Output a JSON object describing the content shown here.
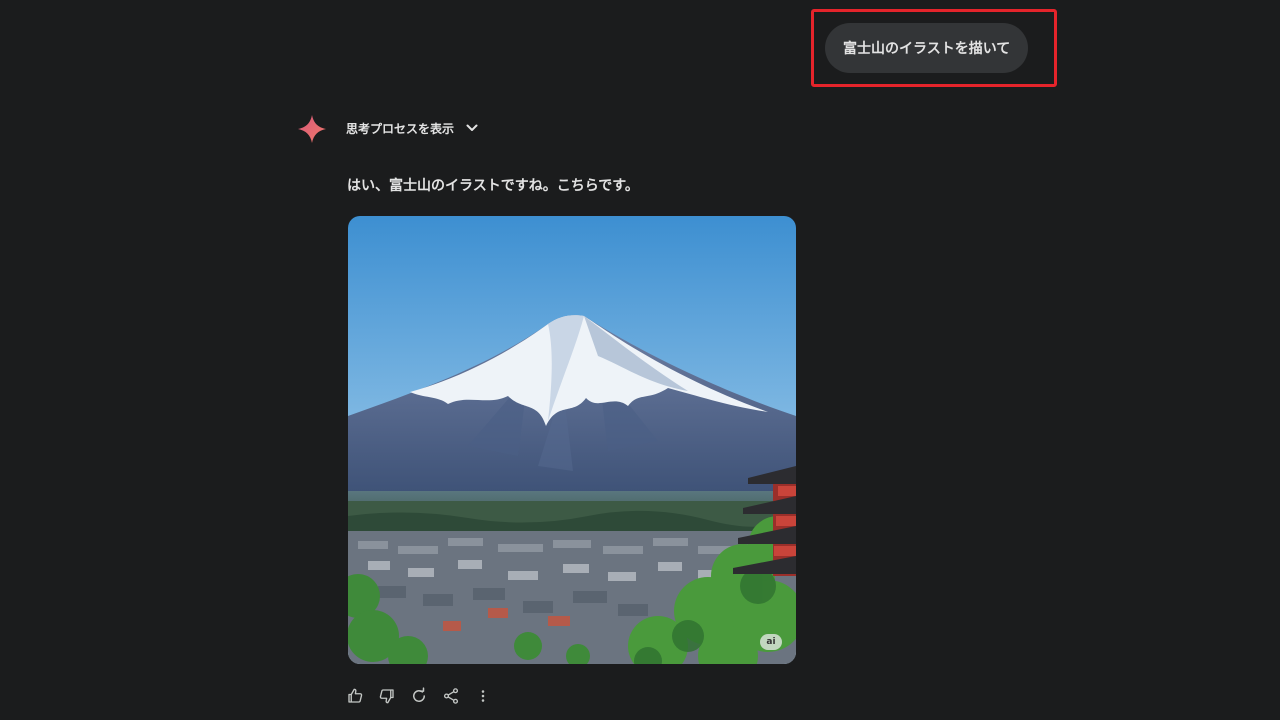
{
  "user_message": {
    "text": "富士山のイラストを描いて"
  },
  "response": {
    "thinking_toggle_label": "思考プロセスを表示",
    "text": "はい、富士山のイラストですね。こちらです。",
    "image": {
      "subject": "Mount Fuji with town and pagoda",
      "badge": "ai"
    }
  },
  "actions": [
    {
      "name": "thumbs-up",
      "icon": "thumbs-up-icon"
    },
    {
      "name": "thumbs-down",
      "icon": "thumbs-down-icon"
    },
    {
      "name": "regenerate",
      "icon": "refresh-icon"
    },
    {
      "name": "share",
      "icon": "share-icon"
    },
    {
      "name": "more",
      "icon": "more-vertical-icon"
    }
  ],
  "colors": {
    "background": "#1b1c1d",
    "bubble": "#333537",
    "highlight": "#e5242b",
    "sparkle": "#e8646c"
  }
}
